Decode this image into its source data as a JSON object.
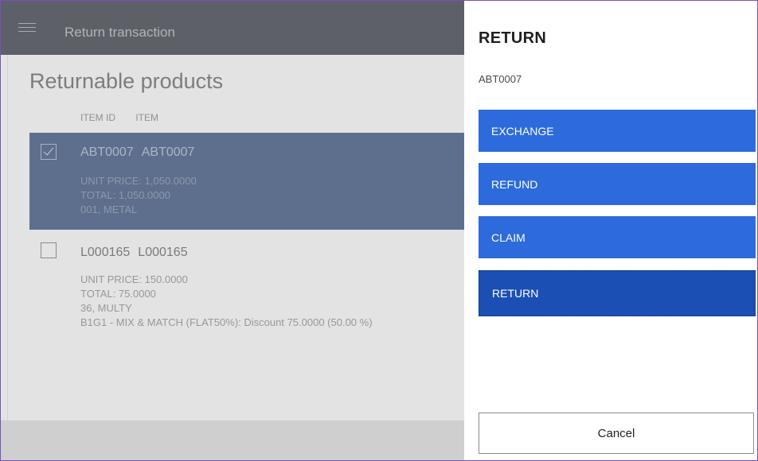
{
  "app": {
    "header_title": "Return transaction",
    "page_title": "Returnable products",
    "columns": [
      "ITEM ID",
      "ITEM"
    ],
    "items": [
      {
        "item_id": "ABT0007",
        "item_name": "ABT0007",
        "checked": true,
        "details": [
          "UNIT PRICE: 1,050.0000",
          "TOTAL: 1,050.0000",
          "001, METAL"
        ]
      },
      {
        "item_id": "L000165",
        "item_name": "L000165",
        "checked": false,
        "details": [
          "UNIT PRICE: 150.0000",
          "TOTAL: 75.0000",
          "36, MULTY",
          "B1G1 - MIX & MATCH (FLAT50%): Discount 75.0000 (50.00 %)"
        ]
      }
    ]
  },
  "panel": {
    "title": "RETURN",
    "subtitle": "ABT0007",
    "options": [
      {
        "label": "EXCHANGE",
        "selected": false
      },
      {
        "label": "REFUND",
        "selected": false
      },
      {
        "label": "CLAIM",
        "selected": false
      },
      {
        "label": "RETURN",
        "selected": true
      }
    ],
    "cancel_label": "Cancel"
  },
  "colors": {
    "accent": "#2d6bdc",
    "accent_selected": "#1c4fb4",
    "header_bg": "#5d6067",
    "selected_row_bg": "#5e6f8d",
    "window_border": "#7a4fc8"
  }
}
